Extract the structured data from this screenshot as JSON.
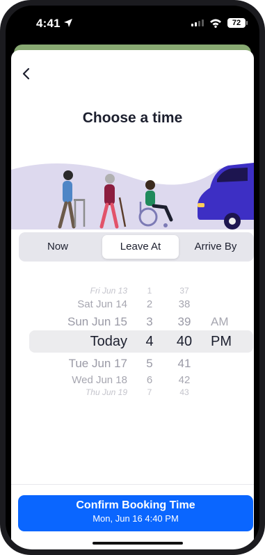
{
  "status_bar": {
    "time": "4:41",
    "battery": "72"
  },
  "header": {
    "title": "Choose a time"
  },
  "mode_tabs": [
    {
      "label": "Now",
      "active": false
    },
    {
      "label": "Leave At",
      "active": true
    },
    {
      "label": "Arrive By",
      "active": false
    }
  ],
  "picker": {
    "days": [
      "Fri Jun 13",
      "Sat Jun 14",
      "Sun Jun 15",
      "Today",
      "Tue Jun 17",
      "Wed Jun 18",
      "Thu Jun 19"
    ],
    "hours": [
      "1",
      "2",
      "3",
      "4",
      "5",
      "6",
      "7"
    ],
    "minutes": [
      "37",
      "38",
      "39",
      "40",
      "41",
      "42",
      "43"
    ],
    "periods": [
      "AM",
      "PM"
    ],
    "selected": {
      "day": "Today",
      "hour": "4",
      "minute": "40",
      "period": "PM"
    }
  },
  "confirm": {
    "label": "Confirm Booking Time",
    "sublabel": "Mon, Jun 16 4:40 PM"
  },
  "colors": {
    "accent": "#0a66ff",
    "van": "#3d2fc4",
    "hill": "#ddd9ee",
    "map": "#88a972"
  },
  "icons": [
    "location-arrow-icon",
    "signal-icon",
    "wifi-icon",
    "battery-icon",
    "back-chevron-icon"
  ]
}
